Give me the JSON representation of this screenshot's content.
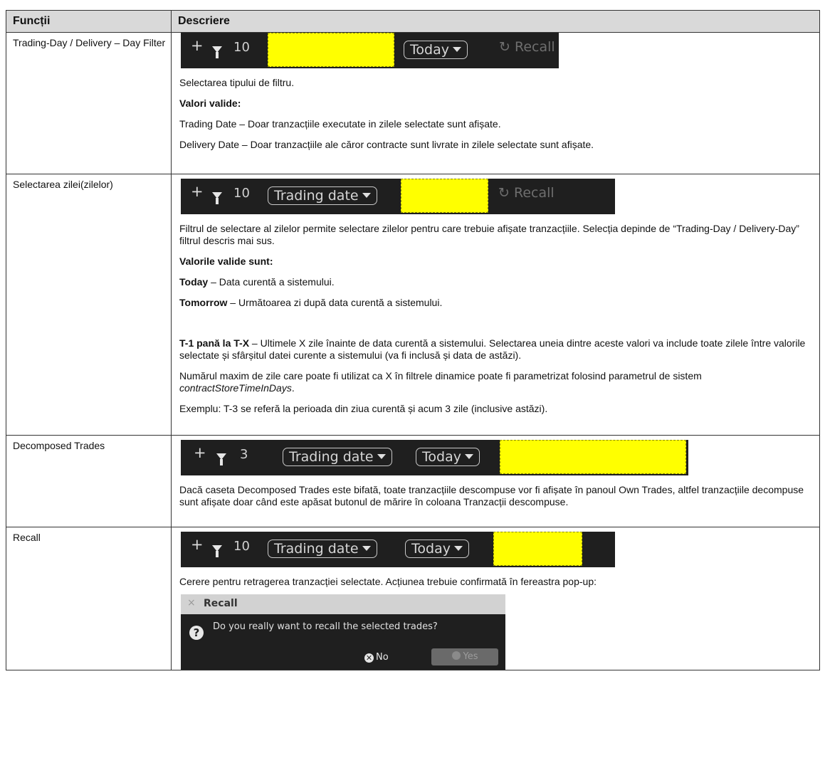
{
  "table": {
    "header": {
      "col1": "Funcții",
      "col2": "Descriere"
    }
  },
  "rows": {
    "filter": {
      "name": "Trading-Day  / Delivery – Day Filter",
      "bar": {
        "plus": "+",
        "count": "10",
        "today": "Today",
        "recall": "Recall"
      },
      "p1": "Selectarea tipului de filtru.",
      "p2": "Valori valide:",
      "p3": "Trading Date – Doar tranzacțiile executate in zilele selectate sunt afișate.",
      "p4": "Delivery Date – Doar tranzacțiile ale căror contracte sunt livrate in zilele selectate sunt afișate."
    },
    "days": {
      "name": "Selectarea zilei(zilelor)",
      "bar": {
        "plus": "+",
        "count": "10",
        "trading_date": "Trading date",
        "recall": "Recall"
      },
      "p1": "Filtrul de selectare al zilelor permite selectare zilelor pentru care trebuie afișate tranzacțiile. Selecția depinde de “Trading-Day / Delivery-Day” filtrul descris mai sus.",
      "p2": "Valorile valide sunt:",
      "p3_bold": "Today",
      "p3_rest": " – Data curentă a sistemului.",
      "p4_bold": "Tomorrow",
      "p4_rest": " – Următoarea zi după data curentă a sistemului.",
      "p5_bold": "T-1 pană la T-X",
      "p5_rest": " – Ultimele X zile înainte de data curentă a sistemului. Selectarea uneia dintre aceste valori va include toate zilele între valorile selectate și sfârșitul datei curente a sistemului (va fi inclusă și data de astăzi).",
      "p6_start": "Numărul maxim de zile care poate fi utilizat ca X în filtrele dinamice poate fi parametrizat folosind parametrul de sistem ",
      "p6_italic": "contractStoreTimeInDays",
      "p6_end": ".",
      "p7": "Exemplu: T-3 se referă la perioada din ziua curentă și acum 3 zile (inclusive astăzi)."
    },
    "decomposed": {
      "name": "Decomposed Trades",
      "bar": {
        "plus": "+",
        "count": "3",
        "trading_date": "Trading date",
        "today": "Today"
      },
      "p1": "Dacă caseta Decomposed Trades este bifată, toate tranzacțiile descompuse vor fi afișate în panoul Own Trades, altfel tranzacțiile decompuse sunt afișate doar când este apăsat butonul de mărire în coloana Tranzacții descompuse."
    },
    "recall": {
      "name": "Recall",
      "bar": {
        "plus": "+",
        "count": "10",
        "trading_date": "Trading date",
        "today": "Today"
      },
      "p1": "Cerere pentru retragerea tranzacției selectate. Acțiunea trebuie confirmată în fereastra pop-up:",
      "dialog": {
        "close": "×",
        "title": "Recall",
        "question_icon": "?",
        "message": "Do you really want to recall the selected trades?",
        "no": "No",
        "yes": "Yes"
      }
    }
  },
  "colors": {
    "toolbar_bg": "#1f1f1f",
    "highlight": "#ffff00",
    "header_bg": "#d9d9d9"
  }
}
